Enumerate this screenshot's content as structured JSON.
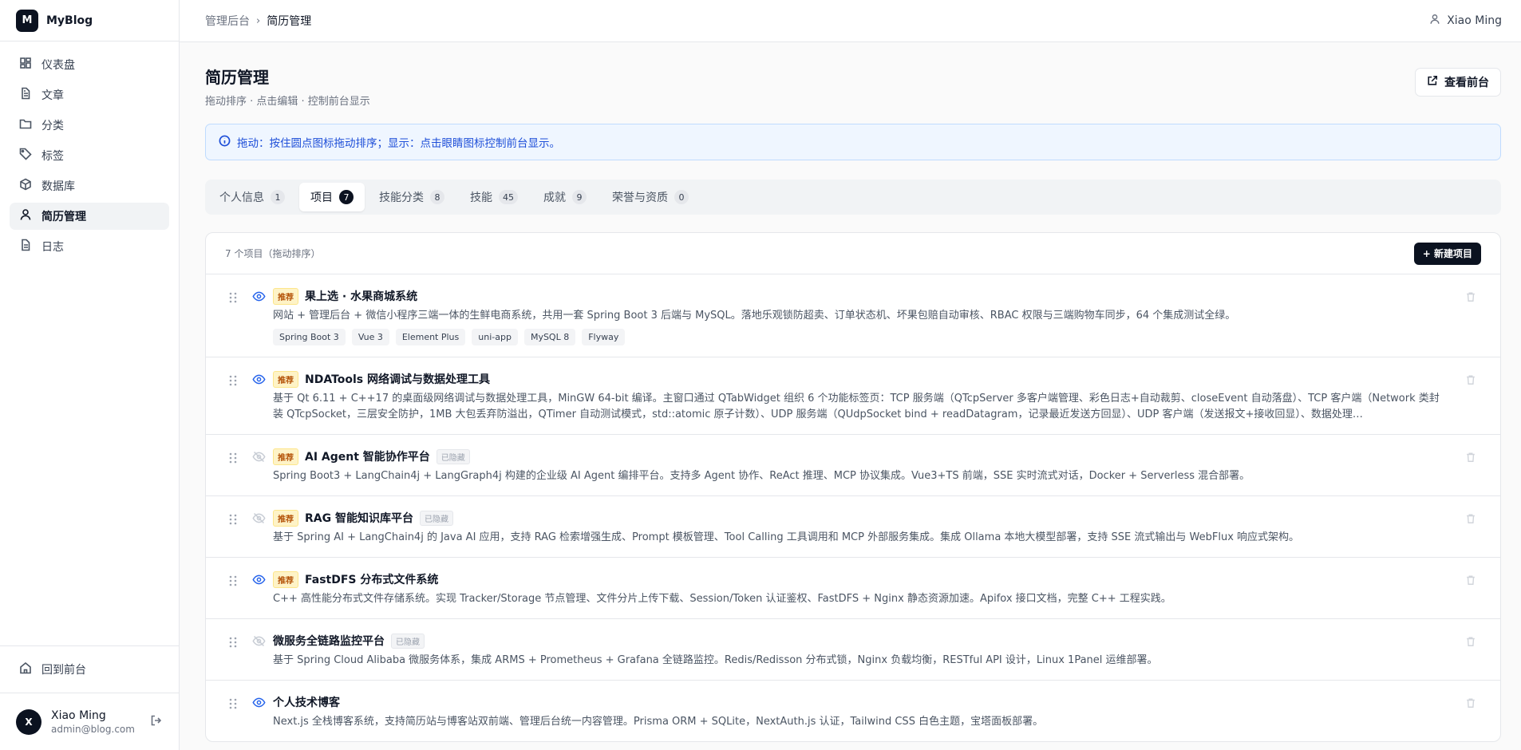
{
  "brand": {
    "logo": "M",
    "name": "MyBlog"
  },
  "sidebar": {
    "items": [
      {
        "label": "仪表盘",
        "icon": "dashboard-icon"
      },
      {
        "label": "文章",
        "icon": "file-icon"
      },
      {
        "label": "分类",
        "icon": "folder-icon"
      },
      {
        "label": "标签",
        "icon": "tag-icon"
      },
      {
        "label": "数据库",
        "icon": "database-icon"
      },
      {
        "label": "简历管理",
        "icon": "user-icon",
        "active": true
      },
      {
        "label": "日志",
        "icon": "log-icon"
      }
    ],
    "back_label": "回到前台"
  },
  "user": {
    "initial": "X",
    "name": "Xiao Ming",
    "email": "admin@blog.com"
  },
  "topbar": {
    "crumb_parent": "管理后台",
    "crumb_current": "简历管理",
    "user_name": "Xiao Ming"
  },
  "page": {
    "title": "简历管理",
    "subtitle": "拖动排序 · 点击编辑 · 控制前台显示",
    "view_button": "查看前台",
    "alert": "拖动：按住圆点图标拖动排序；显示：点击眼睛图标控制前台显示。"
  },
  "tabs": [
    {
      "label": "个人信息",
      "count": "1"
    },
    {
      "label": "项目",
      "count": "7",
      "active": true
    },
    {
      "label": "技能分类",
      "count": "8"
    },
    {
      "label": "技能",
      "count": "45"
    },
    {
      "label": "成就",
      "count": "9"
    },
    {
      "label": "荣誉与资质",
      "count": "0"
    }
  ],
  "list": {
    "count_label": "7 个项目（拖动排序）",
    "new_button": "+ 新建项目",
    "recommend_label": "推荐",
    "hidden_label": "已隐藏",
    "items": [
      {
        "title": "果上选 · 水果商城系统",
        "recommended": true,
        "visible": true,
        "desc": "网站 + 管理后台 + 微信小程序三端一体的生鲜电商系统，共用一套 Spring Boot 3 后端与 MySQL。落地乐观锁防超卖、订单状态机、坏果包赔自动审核、RBAC 权限与三端购物车同步，64 个集成测试全绿。",
        "tags": [
          "Spring Boot 3",
          "Vue 3",
          "Element Plus",
          "uni-app",
          "MySQL 8",
          "Flyway"
        ]
      },
      {
        "title": "NDATools 网络调试与数据处理工具",
        "recommended": true,
        "visible": true,
        "desc": "基于 Qt 6.11 + C++17 的桌面级网络调试与数据处理工具，MinGW 64-bit 编译。主窗口通过 QTabWidget 组织 6 个功能标签页：TCP 服务端（QTcpServer 多客户端管理、彩色日志+自动裁剪、closeEvent 自动落盘）、TCP 客户端（Network 类封装 QTcpSocket，三层安全防护，1MB 大包丢弃防溢出，QTimer 自动测试模式，std::atomic 原子计数）、UDP 服务端（QUdpSocket bind + readDatagram，记录最近发送方回显）、UDP 客户端（发送报文+接收回显）、数据处理…",
        "tags": []
      },
      {
        "title": "AI Agent 智能协作平台",
        "recommended": true,
        "visible": false,
        "desc": "Spring Boot3 + LangChain4j + LangGraph4j 构建的企业级 AI Agent 编排平台。支持多 Agent 协作、ReAct 推理、MCP 协议集成。Vue3+TS 前端，SSE 实时流式对话，Docker + Serverless 混合部署。",
        "tags": []
      },
      {
        "title": "RAG 智能知识库平台",
        "recommended": true,
        "visible": false,
        "desc": "基于 Spring AI + LangChain4j 的 Java AI 应用，支持 RAG 检索增强生成、Prompt 模板管理、Tool Calling 工具调用和 MCP 外部服务集成。集成 Ollama 本地大模型部署，支持 SSE 流式输出与 WebFlux 响应式架构。",
        "tags": []
      },
      {
        "title": "FastDFS 分布式文件系统",
        "recommended": true,
        "visible": true,
        "desc": "C++ 高性能分布式文件存储系统。实现 Tracker/Storage 节点管理、文件分片上传下载、Session/Token 认证鉴权、FastDFS + Nginx 静态资源加速。Apifox 接口文档，完整 C++ 工程实践。",
        "tags": []
      },
      {
        "title": "微服务全链路监控平台",
        "recommended": false,
        "visible": false,
        "desc": "基于 Spring Cloud Alibaba 微服务体系，集成 ARMS + Prometheus + Grafana 全链路监控。Redis/Redisson 分布式锁，Nginx 负载均衡，RESTful API 设计，Linux 1Panel 运维部署。",
        "tags": []
      },
      {
        "title": "个人技术博客",
        "recommended": false,
        "visible": true,
        "desc": "Next.js 全栈博客系统，支持简历站与博客站双前端、管理后台统一内容管理。Prisma ORM + SQLite，NextAuth.js 认证，Tailwind CSS 白色主题，宝塔面板部署。",
        "tags": []
      }
    ]
  }
}
